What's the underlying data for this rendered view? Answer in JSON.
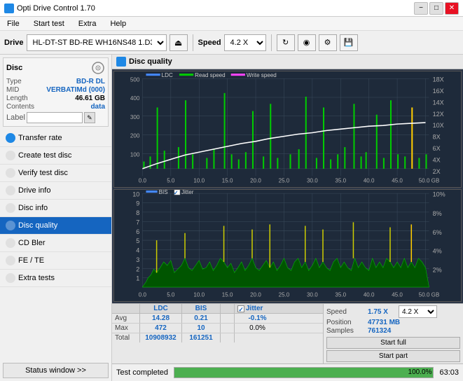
{
  "app": {
    "title": "Opti Drive Control 1.70",
    "icon": "disc-icon"
  },
  "titlebar": {
    "minimize": "−",
    "maximize": "□",
    "close": "✕"
  },
  "menu": {
    "items": [
      "File",
      "Start test",
      "Extra",
      "Help"
    ]
  },
  "toolbar": {
    "drive_label": "Drive",
    "drive_value": "(G:)  HL-DT-ST BD-RE  WH16NS48 1.D3",
    "speed_label": "Speed",
    "speed_value": "4.2 X"
  },
  "disc": {
    "type_label": "Type",
    "type_value": "BD-R DL",
    "mid_label": "MID",
    "mid_value": "VERBATIMd (000)",
    "length_label": "Length",
    "length_value": "46.61 GB",
    "contents_label": "Contents",
    "contents_value": "data",
    "label_label": "Label"
  },
  "nav": {
    "items": [
      {
        "id": "transfer-rate",
        "label": "Transfer rate",
        "active": false
      },
      {
        "id": "create-test-disc",
        "label": "Create test disc",
        "active": false
      },
      {
        "id": "verify-test-disc",
        "label": "Verify test disc",
        "active": false
      },
      {
        "id": "drive-info",
        "label": "Drive info",
        "active": false
      },
      {
        "id": "disc-info",
        "label": "Disc info",
        "active": false
      },
      {
        "id": "disc-quality",
        "label": "Disc quality",
        "active": true
      },
      {
        "id": "cd-bler",
        "label": "CD Bler",
        "active": false
      },
      {
        "id": "fe-te",
        "label": "FE / TE",
        "active": false
      },
      {
        "id": "extra-tests",
        "label": "Extra tests",
        "active": false
      }
    ]
  },
  "status_btn": "Status window >>",
  "content": {
    "title": "Disc quality",
    "chart1": {
      "title": "LDC / Read speed / Write speed",
      "legend": [
        {
          "id": "ldc",
          "label": "LDC",
          "color": "#4488ff"
        },
        {
          "id": "read",
          "label": "Read speed",
          "color": "#00ff00"
        },
        {
          "id": "write",
          "label": "Write speed",
          "color": "#ff00ff"
        }
      ],
      "y_labels": [
        "500",
        "400",
        "300",
        "200",
        "100"
      ],
      "y_right": [
        "18X",
        "16X",
        "14X",
        "12X",
        "10X",
        "8X",
        "6X",
        "4X",
        "2X"
      ],
      "x_labels": [
        "0.0",
        "5.0",
        "10.0",
        "15.0",
        "20.0",
        "25.0",
        "30.0",
        "35.0",
        "40.0",
        "45.0",
        "50.0 GB"
      ]
    },
    "chart2": {
      "title": "BIS / Jitter",
      "legend": [
        {
          "id": "bis",
          "label": "BIS",
          "color": "#4488ff"
        },
        {
          "id": "jitter",
          "label": "Jitter",
          "color": "#ffff00"
        }
      ],
      "y_labels": [
        "10",
        "9",
        "8",
        "7",
        "6",
        "5",
        "4",
        "3",
        "2",
        "1"
      ],
      "y_right": [
        "10%",
        "8%",
        "6%",
        "4%",
        "2%"
      ],
      "x_labels": [
        "0.0",
        "5.0",
        "10.0",
        "15.0",
        "20.0",
        "25.0",
        "30.0",
        "35.0",
        "40.0",
        "45.0",
        "50.0 GB"
      ]
    }
  },
  "stats": {
    "headers": [
      "LDC",
      "BIS",
      "",
      "Jitter",
      "Speed",
      ""
    ],
    "avg_label": "Avg",
    "avg_ldc": "14.28",
    "avg_bis": "0.21",
    "avg_jitter": "-0.1%",
    "max_label": "Max",
    "max_ldc": "472",
    "max_bis": "10",
    "max_jitter": "0.0%",
    "total_label": "Total",
    "total_ldc": "10908932",
    "total_bis": "161251",
    "speed_label": "Speed",
    "speed_value": "1.75 X",
    "speed_select": "4.2 X",
    "position_label": "Position",
    "position_value": "47731 MB",
    "samples_label": "Samples",
    "samples_value": "761324",
    "start_full": "Start full",
    "start_part": "Start part",
    "jitter_checked": true,
    "jitter_label": "Jitter"
  },
  "statusbar": {
    "text": "Test completed",
    "progress": 100,
    "progress_label": "100.0%",
    "right_value": "63:03"
  }
}
